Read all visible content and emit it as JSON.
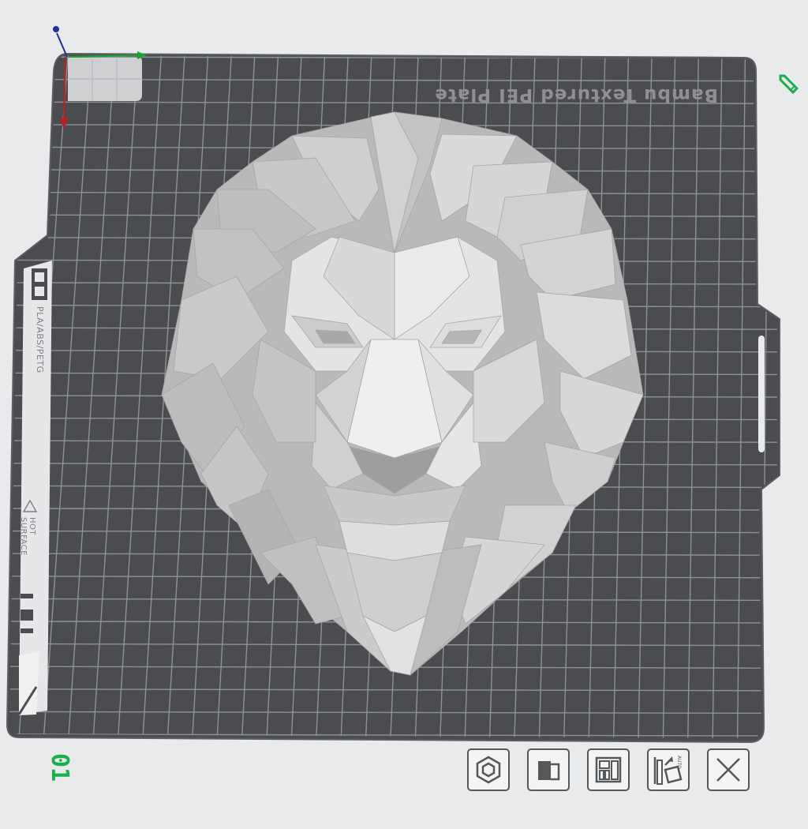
{
  "plate": {
    "name": "Bambu Textured PEI Plate",
    "number": "01",
    "tab_materials": "PLA/ABS/PETG",
    "tab_warning_line1": "HOT",
    "tab_warning_line2": "SURFACE"
  },
  "colors": {
    "background": "#e9eaeb",
    "plate": "#4a4c4f",
    "plate_rim": "#5f6165",
    "grid": "#8b8e92",
    "model": "#c6c6c6",
    "accent_green": "#19b04b",
    "axis_x": "#18a52e",
    "axis_y": "#c21d1d",
    "axis_z": "#1d2f9e"
  },
  "axes": {
    "x_icon": "axis-x-arrow",
    "y_icon": "axis-y-arrow",
    "z_icon": "axis-z-arrow"
  },
  "model": {
    "name": "lion-head-lowpoly",
    "icon": "3d-model"
  },
  "toolbar": {
    "items": [
      {
        "name": "arrange-nut",
        "icon": "hex-nut-icon"
      },
      {
        "name": "orient",
        "icon": "orient-icon"
      },
      {
        "name": "layout",
        "icon": "layout-icon"
      },
      {
        "name": "auto-orient",
        "icon": "auto-orient-icon",
        "badge": "AUTO"
      },
      {
        "name": "close",
        "icon": "close-icon"
      }
    ]
  }
}
